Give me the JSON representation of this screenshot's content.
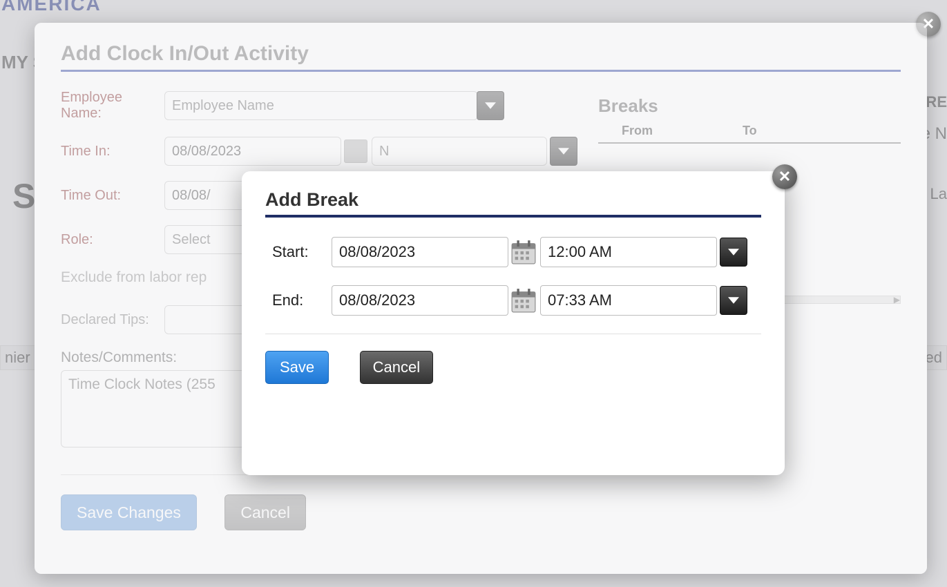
{
  "bg": {
    "logo_fragment": "AMERICA",
    "tab_fragment": "MY S",
    "big_letter": "S",
    "left_tab_fragment": "nier",
    "right_tab_fragment": "ked",
    "right_top1": "ORE",
    "right_top2": "e N",
    "right_top3": "t La"
  },
  "main_dialog": {
    "title": "Add Clock In/Out Activity",
    "labels": {
      "employee": "Employee Name:",
      "time_in": "Time In:",
      "time_out": "Time Out:",
      "role": "Role:",
      "exclude": "Exclude from labor rep",
      "tips": "Declared Tips:",
      "notes": "Notes/Comments:"
    },
    "employee_placeholder": "Employee Name",
    "time_in_date": "08/08/2023",
    "time_in_time_placeholder": "N",
    "time_out_date": "08/08/",
    "role_placeholder": "Select",
    "notes_placeholder": "Time Clock Notes (255",
    "save_label": "Save Changes",
    "cancel_label": "Cancel",
    "breaks": {
      "heading": "Breaks",
      "col_from": "From",
      "col_to": "To"
    }
  },
  "break_dialog": {
    "title": "Add Break",
    "start_label": "Start:",
    "end_label": "End:",
    "start_date": "08/08/2023",
    "start_time": "12:00 AM",
    "end_date": "08/08/2023",
    "end_time": "07:33 AM",
    "save_label": "Save",
    "cancel_label": "Cancel"
  }
}
